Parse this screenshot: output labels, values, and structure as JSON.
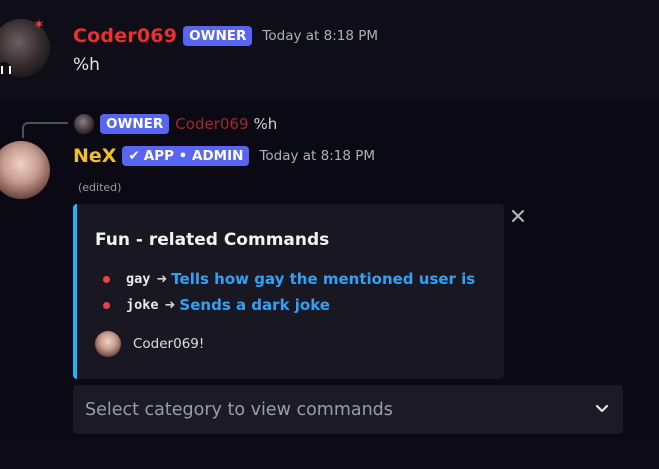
{
  "message1": {
    "author": "Coder069",
    "badge": "OWNER",
    "timestamp": "Today at 8:18 PM",
    "content": "%h"
  },
  "reply": {
    "badge": "OWNER",
    "author": "Coder069",
    "content": "%h"
  },
  "message2": {
    "author": "NeX",
    "badge_check": "✔",
    "badge": "APP • ADMIN",
    "timestamp": "Today at 8:18 PM",
    "edited": "(edited)"
  },
  "embed": {
    "accent_color": "#28b0f0",
    "title": "Fun - related Commands",
    "commands": [
      {
        "name": "gay",
        "arrow": "➜",
        "description": "Tells how gay the mentioned user is"
      },
      {
        "name": "joke",
        "arrow": "➜",
        "description": "Sends a dark joke"
      }
    ],
    "footer": "Coder069!",
    "close_icon": "close-icon"
  },
  "select": {
    "placeholder": "Select category to view commands",
    "icon": "chevron-down-icon"
  },
  "colors": {
    "owner_name": "#e8302d",
    "bot_name": "#f0c02a",
    "badge": "#5865f2",
    "link": "#2ea2f6",
    "bullet": "#ed4245"
  }
}
